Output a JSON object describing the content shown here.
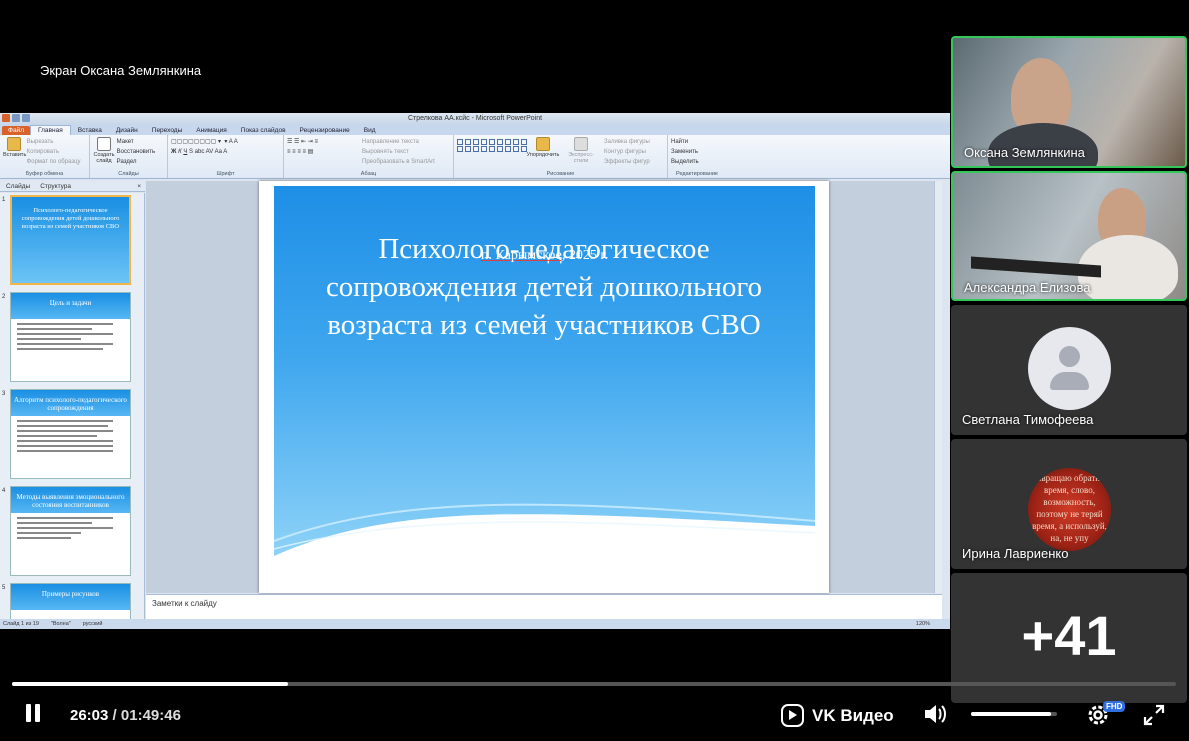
{
  "screen_label": "Экран Оксана Землянкина",
  "ppt": {
    "window_title": "Стрелкова АА.ксйс - Microsoft PowerPoint",
    "file_tab": "Файл",
    "tabs": [
      "Главная",
      "Вставка",
      "Дизайн",
      "Переходы",
      "Анимация",
      "Показ слайдов",
      "Рецензирование",
      "Вид"
    ],
    "ribbon": {
      "clipboard": {
        "paste": "Вставить",
        "cut": "Вырезать",
        "copy": "Копировать",
        "format": "Формат по образцу",
        "group": "Буфер обмена"
      },
      "slides": {
        "new_slide": "Создать слайд",
        "layout": "Макет",
        "reset": "Восстановить",
        "section": "Раздел",
        "group": "Слайды"
      },
      "font_group": "Шрифт",
      "paragraph": {
        "direction": "Направление текста",
        "align": "Выровнять текст",
        "smartart": "Преобразовать в SmartArt",
        "group": "Абзац"
      },
      "drawing": {
        "arrange": "Упорядочить",
        "quick_styles": "Экспресс-стили",
        "fill": "Заливка фигуры",
        "outline": "Контур фигуры",
        "effects": "Эффекты фигур",
        "group": "Рисование"
      },
      "editing": {
        "find": "Найти",
        "replace": "Заменить",
        "select": "Выделить",
        "group": "Редактирование"
      }
    },
    "pane_tabs": [
      "Слайды",
      "Структура"
    ],
    "thumbnails": [
      {
        "num": "1",
        "title": "Психолого-педагогическое сопровождения детей дошкольного возраста из семей участников СВО"
      },
      {
        "num": "2",
        "title": "Цель и задачи"
      },
      {
        "num": "3",
        "title": "Алгоритм психолого-педагогического сопровождения"
      },
      {
        "num": "4",
        "title": "Методы выявления эмоционального состояния воспитанников"
      },
      {
        "num": "5",
        "title": "Примеры рисунков"
      }
    ],
    "slide": {
      "title": "Психолого-педагогическое сопровождения детей дошкольного возраста из семей участников СВО",
      "subtitle_place": "п. Карымское,",
      "subtitle_year": " 2025 г."
    },
    "notes_placeholder": "Заметки к слайду",
    "status": {
      "slide_count": "Слайд 1 из 19",
      "theme": "\"Волна\"",
      "language": "русский",
      "zoom": "120%"
    }
  },
  "participants": [
    {
      "name": "Оксана Землянкина",
      "speaking": true
    },
    {
      "name": "Александра Елизова",
      "speaking": true
    },
    {
      "name": "Светлана Тимофеева",
      "speaking": false
    },
    {
      "name": "Ирина Лавриенко",
      "speaking": false
    }
  ],
  "photo_text": "возвращаю обратно - время, слово, возможность, поэтому не теряй время, а используй, на, не упу",
  "more_participants": "+41",
  "player": {
    "current_time": "26:03",
    "separator": " / ",
    "duration": "01:49:46",
    "progress": 0.237,
    "brand": "VK Видео",
    "volume": 0.93,
    "quality_badge": "FHD"
  },
  "colors": {
    "speaking_border": "#34c759",
    "slide_blue": "#1e8fe6",
    "quality_badge": "#2f6fe0"
  }
}
